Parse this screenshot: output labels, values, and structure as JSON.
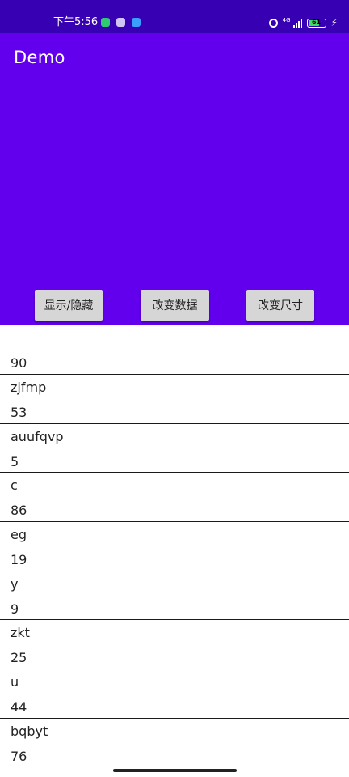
{
  "status_bar": {
    "time": "下午5:56",
    "network": "4G",
    "battery_level": "61",
    "icons": [
      "wechat-notification-icon",
      "gallery-notification-icon",
      "message-notification-icon",
      "alarm-icon",
      "signal-icon",
      "battery-icon",
      "charging-icon"
    ]
  },
  "app_bar": {
    "title": "Demo"
  },
  "buttons": {
    "toggle": "显示/隐藏",
    "change_data": "改变数据",
    "change_size": "改变尺寸"
  },
  "list": {
    "rows": [
      {
        "name": "",
        "number": "90"
      },
      {
        "name": "zjfmp",
        "number": "53"
      },
      {
        "name": "auufqvp",
        "number": "5"
      },
      {
        "name": "c",
        "number": "86"
      },
      {
        "name": "eg",
        "number": "19"
      },
      {
        "name": "y",
        "number": "9"
      },
      {
        "name": "zkt",
        "number": "25"
      },
      {
        "name": "u",
        "number": "44"
      },
      {
        "name": "bqbyt",
        "number": "76"
      }
    ]
  },
  "colors": {
    "status_bar": "#3700b3",
    "app_bar": "#6200ee",
    "button_bg": "#d6d6d6"
  }
}
